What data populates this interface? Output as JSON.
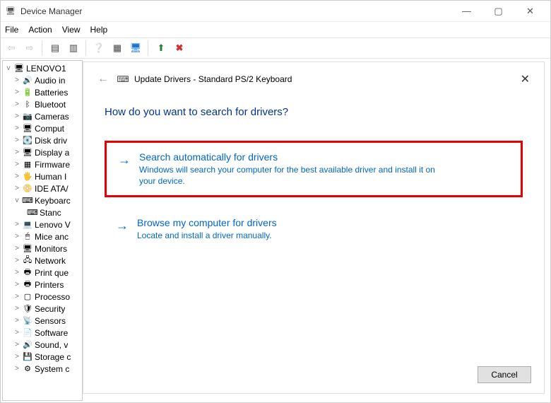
{
  "window": {
    "title": "Device Manager"
  },
  "menu": {
    "file": "File",
    "action": "Action",
    "view": "View",
    "help": "Help"
  },
  "tree": {
    "root": "LENOVO1",
    "items": [
      {
        "label": "Audio in",
        "expander": ">",
        "icon": "🔊"
      },
      {
        "label": "Batteries",
        "expander": ">",
        "icon": "🔋"
      },
      {
        "label": "Bluetoot",
        "expander": ">",
        "icon": "ᛒ"
      },
      {
        "label": "Cameras",
        "expander": ">",
        "icon": "📷"
      },
      {
        "label": "Comput",
        "expander": ">",
        "icon": "🖥"
      },
      {
        "label": "Disk driv",
        "expander": ">",
        "icon": "💽"
      },
      {
        "label": "Display a",
        "expander": ">",
        "icon": "🖥"
      },
      {
        "label": "Firmware",
        "expander": ">",
        "icon": "▦"
      },
      {
        "label": "Human I",
        "expander": ">",
        "icon": "🖐"
      },
      {
        "label": "IDE ATA/",
        "expander": ">",
        "icon": "📀"
      },
      {
        "label": "Keyboarc",
        "expander": "v",
        "icon": "⌨",
        "child": {
          "label": "Stanc",
          "icon": "⌨"
        }
      },
      {
        "label": "Lenovo V",
        "expander": ">",
        "icon": "💻"
      },
      {
        "label": "Mice anc",
        "expander": ">",
        "icon": "🖱"
      },
      {
        "label": "Monitors",
        "expander": ">",
        "icon": "🖥"
      },
      {
        "label": "Network",
        "expander": ">",
        "icon": "🖧"
      },
      {
        "label": "Print que",
        "expander": ">",
        "icon": "🖶"
      },
      {
        "label": "Printers",
        "expander": ">",
        "icon": "🖶"
      },
      {
        "label": "Processo",
        "expander": ">",
        "icon": "▢"
      },
      {
        "label": "Security",
        "expander": ">",
        "icon": "🛡"
      },
      {
        "label": "Sensors",
        "expander": ">",
        "icon": "📡"
      },
      {
        "label": "Software",
        "expander": ">",
        "icon": "📄"
      },
      {
        "label": "Sound, v",
        "expander": ">",
        "icon": "🔊"
      },
      {
        "label": "Storage c",
        "expander": ">",
        "icon": "💾"
      },
      {
        "label": "System c",
        "expander": ">",
        "icon": "⚙"
      }
    ]
  },
  "dialog": {
    "title": "Update Drivers - Standard PS/2 Keyboard",
    "heading": "How do you want to search for drivers?",
    "options": [
      {
        "title": "Search automatically for drivers",
        "desc": "Windows will search your computer for the best available driver and install it on your device."
      },
      {
        "title": "Browse my computer for drivers",
        "desc": "Locate and install a driver manually."
      }
    ],
    "cancel": "Cancel"
  }
}
